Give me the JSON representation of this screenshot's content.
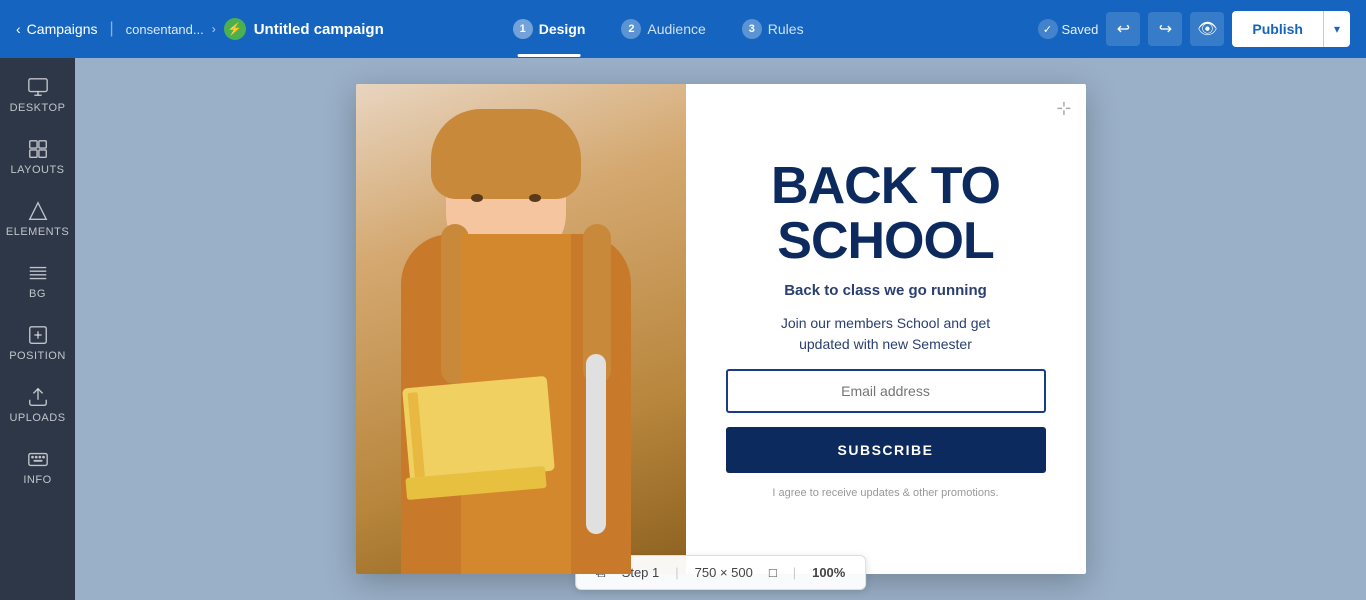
{
  "topnav": {
    "back_label": "Campaigns",
    "brand_label": "consentand...",
    "campaign_title": "Untitled campaign",
    "steps": [
      {
        "num": "1",
        "label": "Design",
        "active": true
      },
      {
        "num": "2",
        "label": "Audience",
        "active": false
      },
      {
        "num": "3",
        "label": "Rules",
        "active": false
      }
    ],
    "saved_label": "Saved",
    "publish_label": "Publish"
  },
  "sidebar": {
    "items": [
      {
        "id": "desktop",
        "label": "DESKTOP",
        "icon": "monitor"
      },
      {
        "id": "layouts",
        "label": "LAYOUTS",
        "icon": "layout"
      },
      {
        "id": "elements",
        "label": "ELEMENTS",
        "icon": "elements"
      },
      {
        "id": "bg",
        "label": "BG",
        "icon": "bg"
      },
      {
        "id": "position",
        "label": "POSITION",
        "icon": "position"
      },
      {
        "id": "uploads",
        "label": "UPLOADS",
        "icon": "upload"
      },
      {
        "id": "info",
        "label": "INFO",
        "icon": "keyboard"
      }
    ]
  },
  "popup": {
    "title_line1": "BACK TO",
    "title_line2": "SCHOOL",
    "subtitle": "Back to class we go running",
    "description": "Join our members School and get\nupdated with new Semester",
    "email_placeholder": "Email address",
    "subscribe_label": "SUBSCRIBE",
    "terms_label": "I agree to receive updates & other promotions."
  },
  "bottombar": {
    "step_label": "Step 1",
    "dimensions": "750 × 500",
    "zoom": "100%"
  }
}
